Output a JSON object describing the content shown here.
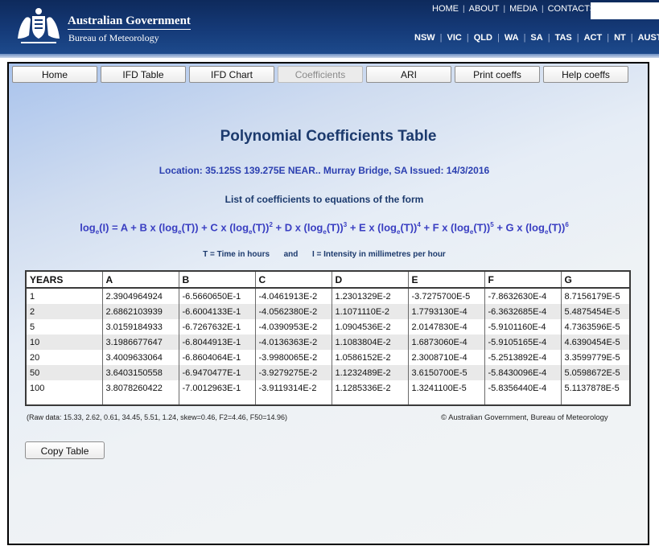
{
  "header": {
    "gov_title": "Australian Government",
    "bom_title": "Bureau of Meteorology",
    "top_links": [
      "HOME",
      "ABOUT",
      "MEDIA",
      "CONTACTS"
    ],
    "state_links": [
      "NSW",
      "VIC",
      "QLD",
      "WA",
      "SA",
      "TAS",
      "ACT",
      "NT",
      "AUSTRA"
    ],
    "search_value": ""
  },
  "tabs": [
    {
      "label": "Home",
      "active": false
    },
    {
      "label": "IFD Table",
      "active": false
    },
    {
      "label": "IFD Chart",
      "active": false
    },
    {
      "label": "Coefficients",
      "active": true
    },
    {
      "label": "ARI",
      "active": false
    },
    {
      "label": "Print coeffs",
      "active": false
    },
    {
      "label": "Help coeffs",
      "active": false
    }
  ],
  "main": {
    "title": "Polynomial Coefficients Table",
    "location": "Location: 35.125S  139.275E  NEAR..  Murray Bridge, SA  Issued: 14/3/2016",
    "list_heading": "List of coefficients to equations of the form",
    "units_time": "T = Time in hours",
    "units_and": "and",
    "units_intensity": "I = Intensity in millimetres per hour",
    "raw_data": "(Raw data: 15.33, 2.62, 0.61, 34.45, 5.51, 1.24, skew=0.46, F2=4.46, F50=14.96)",
    "copyright": "© Australian Government, Bureau of Meteorology",
    "copy_button": "Copy Table"
  },
  "table": {
    "columns": [
      "YEARS",
      "A",
      "B",
      "C",
      "D",
      "E",
      "F",
      "G"
    ],
    "rows": [
      [
        "1",
        "2.3904964924",
        "-6.5660650E-1",
        "-4.0461913E-2",
        "1.2301329E-2",
        "-3.7275700E-5",
        "-7.8632630E-4",
        "8.7156179E-5"
      ],
      [
        "2",
        "2.6862103939",
        "-6.6004133E-1",
        "-4.0562380E-2",
        "1.1071110E-2",
        "1.7793130E-4",
        "-6.3632685E-4",
        "5.4875454E-5"
      ],
      [
        "5",
        "3.0159184933",
        "-6.7267632E-1",
        "-4.0390953E-2",
        "1.0904536E-2",
        "2.0147830E-4",
        "-5.9101160E-4",
        "4.7363596E-5"
      ],
      [
        "10",
        "3.1986677647",
        "-6.8044913E-1",
        "-4.0136363E-2",
        "1.1083804E-2",
        "1.6873060E-4",
        "-5.9105165E-4",
        "4.6390454E-5"
      ],
      [
        "20",
        "3.4009633064",
        "-6.8604064E-1",
        "-3.9980065E-2",
        "1.0586152E-2",
        "2.3008710E-4",
        "-5.2513892E-4",
        "3.3599779E-5"
      ],
      [
        "50",
        "3.6403150558",
        "-6.9470477E-1",
        "-3.9279275E-2",
        "1.1232489E-2",
        "3.6150700E-5",
        "-5.8430096E-4",
        "5.0598672E-5"
      ],
      [
        "100",
        "3.8078260422",
        "-7.0012963E-1",
        "-3.9119314E-2",
        "1.1285336E-2",
        "1.3241100E-5",
        "-5.8356440E-4",
        "5.1137878E-5"
      ]
    ]
  },
  "colors": {
    "header_bg": "#153a78",
    "title_color": "#1c3a6d",
    "location_color": "#2b3fb0",
    "equation_color": "#3a3fc2"
  }
}
